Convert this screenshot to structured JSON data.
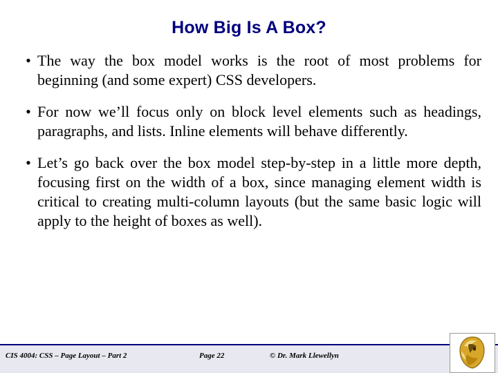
{
  "slide": {
    "title": "How Big Is A Box?",
    "bullet_char": "•",
    "bullets": [
      "The way the box model works is the root of most problems for beginning (and some expert) CSS developers.",
      "For now we’ll focus only on block level elements such as headings, paragraphs, and lists.   Inline elements will behave differently.",
      "Let’s go back over the box model step-by-step in a little more depth, focusing first on the width of a box, since managing element width is critical to creating multi-column layouts (but the same basic logic will apply to the height of boxes as well)."
    ]
  },
  "footer": {
    "left": "CIS 4004: CSS – Page Layout – Part 2",
    "center": "Page 22",
    "right": "© Dr. Mark Llewellyn",
    "logo_name": "ucf-pegasus-logo"
  },
  "colors": {
    "title": "#000080",
    "footer_band": "#e8e8f0",
    "footer_rule": "#000080",
    "text": "#000000",
    "logo_gold": "#d4a017",
    "logo_dark": "#4a3000"
  }
}
